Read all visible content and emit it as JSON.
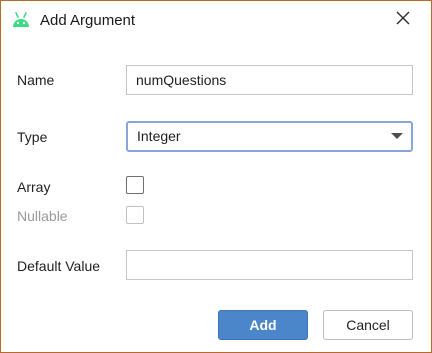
{
  "dialog": {
    "title": "Add Argument",
    "icon": "android-icon",
    "accent_color": "#3ddc84"
  },
  "form": {
    "name_label": "Name",
    "name_value": "numQuestions",
    "type_label": "Type",
    "type_value": "Integer",
    "array_label": "Array",
    "array_checked": false,
    "nullable_label": "Nullable",
    "nullable_checked": false,
    "nullable_enabled": false,
    "default_value_label": "Default Value",
    "default_value": ""
  },
  "buttons": {
    "add_label": "Add",
    "cancel_label": "Cancel"
  },
  "colors": {
    "primary_button": "#4a86c9",
    "focus_border": "#86a6d8",
    "window_border": "#b86a2c"
  }
}
